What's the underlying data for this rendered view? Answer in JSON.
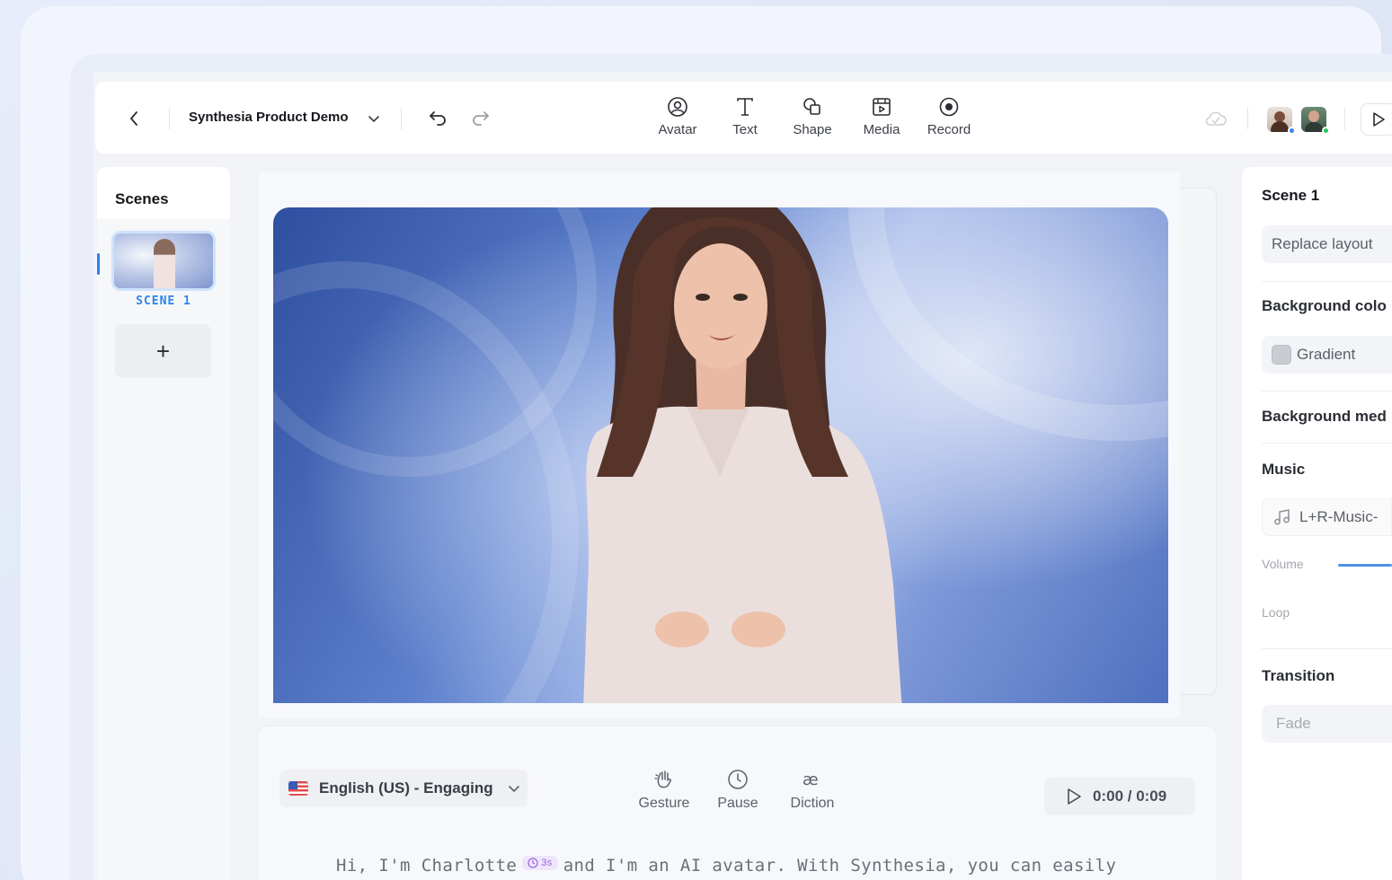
{
  "header": {
    "project_title": "Synthesia Product Demo",
    "tools": [
      {
        "label": "Avatar",
        "icon": "avatar-icon"
      },
      {
        "label": "Text",
        "icon": "text-icon"
      },
      {
        "label": "Shape",
        "icon": "shape-icon"
      },
      {
        "label": "Media",
        "icon": "media-icon"
      },
      {
        "label": "Record",
        "icon": "record-icon"
      }
    ],
    "collaborators": [
      {
        "name": "collaborator-1",
        "status_color": "#3b82f6"
      },
      {
        "name": "collaborator-2",
        "status_color": "#22c55e"
      }
    ]
  },
  "scenes": {
    "title": "Scenes",
    "items": [
      {
        "label": "SCENE 1"
      }
    ],
    "add_label": "+"
  },
  "script": {
    "language": "English (US) - Engaging",
    "tools": [
      {
        "label": "Gesture",
        "icon": "gesture-icon"
      },
      {
        "label": "Pause",
        "icon": "clock-icon"
      },
      {
        "label": "Diction",
        "icon": "diction-icon"
      }
    ],
    "time": "0:00 / 0:09",
    "text_before": "Hi, I'm Charlotte",
    "pause_chip": "3s",
    "text_after": "and I'm an AI avatar. With Synthesia, you can easily"
  },
  "properties": {
    "title": "Scene 1",
    "replace_layout": "Replace layout",
    "background_color_heading": "Background colo",
    "background_color_value": "Gradient",
    "background_media_heading": "Background med",
    "music_heading": "Music",
    "music_track": "L+R-Music-",
    "volume_label": "Volume",
    "loop_label": "Loop",
    "transition_heading": "Transition",
    "transition_value": "Fade"
  }
}
